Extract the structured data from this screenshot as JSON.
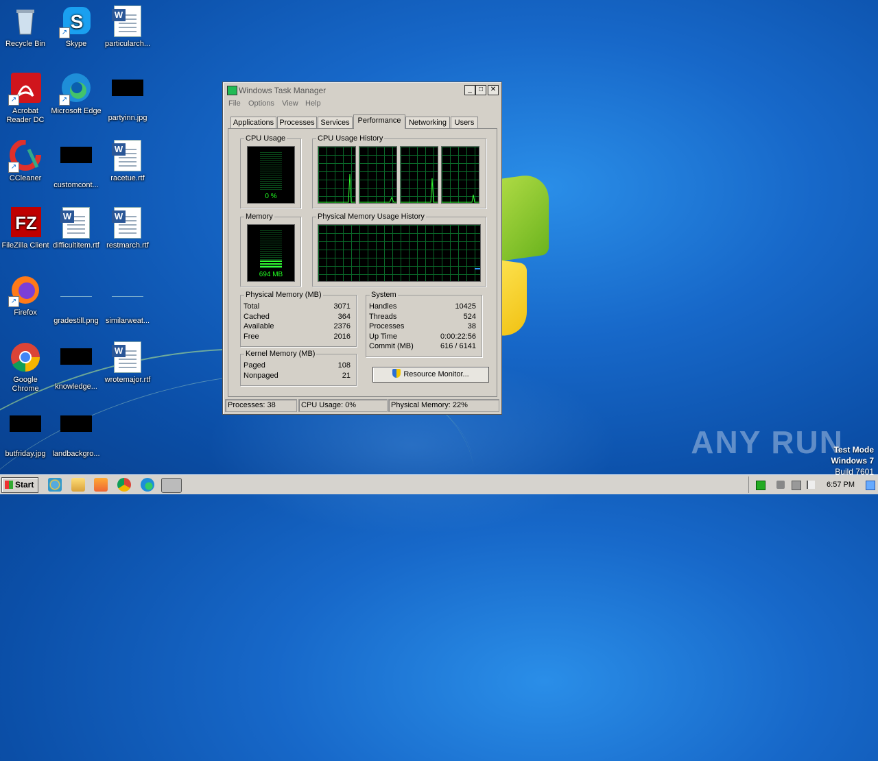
{
  "desktop": {
    "icons": [
      {
        "label": "Recycle Bin"
      },
      {
        "label": "Skype"
      },
      {
        "label": "particularch..."
      },
      {
        "label": "Acrobat Reader DC"
      },
      {
        "label": "Microsoft Edge"
      },
      {
        "label": "partyinn.jpg"
      },
      {
        "label": "CCleaner"
      },
      {
        "label": "customcont..."
      },
      {
        "label": "racetue.rtf"
      },
      {
        "label": "FileZilla Client"
      },
      {
        "label": "difficultitem.rtf"
      },
      {
        "label": "restmarch.rtf"
      },
      {
        "label": "Firefox"
      },
      {
        "label": "gradestill.png"
      },
      {
        "label": "similarweat..."
      },
      {
        "label": "Google Chrome"
      },
      {
        "label": "knowledge..."
      },
      {
        "label": "wrotemajor.rtf"
      },
      {
        "label": "butfriday.jpg"
      },
      {
        "label": "landbackgro..."
      }
    ]
  },
  "window": {
    "title": "Windows Task Manager",
    "controls": {
      "minimize": "_",
      "maximize": "□",
      "close": "✕"
    },
    "menu": [
      "File",
      "Options",
      "View",
      "Help"
    ],
    "tabs": [
      "Applications",
      "Processes",
      "Services",
      "Performance",
      "Networking",
      "Users"
    ],
    "active_tab": "Performance",
    "groups": {
      "cpu_usage": {
        "caption": "CPU Usage",
        "value": "0 %",
        "level": 0.0
      },
      "cpu_history": {
        "caption": "CPU Usage History"
      },
      "memory": {
        "caption": "Memory",
        "value": "694 MB",
        "level": 0.22
      },
      "mem_history": {
        "caption": "Physical Memory Usage History"
      }
    },
    "physical_memory": {
      "caption": "Physical Memory (MB)",
      "rows": [
        {
          "k": "Total",
          "v": "3071"
        },
        {
          "k": "Cached",
          "v": "364"
        },
        {
          "k": "Available",
          "v": "2376"
        },
        {
          "k": "Free",
          "v": "2016"
        }
      ]
    },
    "kernel_memory": {
      "caption": "Kernel Memory (MB)",
      "rows": [
        {
          "k": "Paged",
          "v": "108"
        },
        {
          "k": "Nonpaged",
          "v": "21"
        }
      ]
    },
    "system": {
      "caption": "System",
      "rows": [
        {
          "k": "Handles",
          "v": "10425"
        },
        {
          "k": "Threads",
          "v": "524"
        },
        {
          "k": "Processes",
          "v": "38"
        },
        {
          "k": "Up Time",
          "v": "0:00:22:56"
        },
        {
          "k": "Commit (MB)",
          "v": "616 / 6141"
        }
      ]
    },
    "resource_monitor_button": "Resource Monitor...",
    "status": {
      "processes": "Processes: 38",
      "cpu": "CPU Usage: 0%",
      "memory": "Physical Memory: 22%"
    }
  },
  "taskbar": {
    "start_label": "Start",
    "clock": "6:57 PM"
  },
  "watermark": "ANY RUN",
  "test_mode": {
    "line1": "Test Mode",
    "line2": "Windows 7",
    "line3": "Build 7601"
  }
}
